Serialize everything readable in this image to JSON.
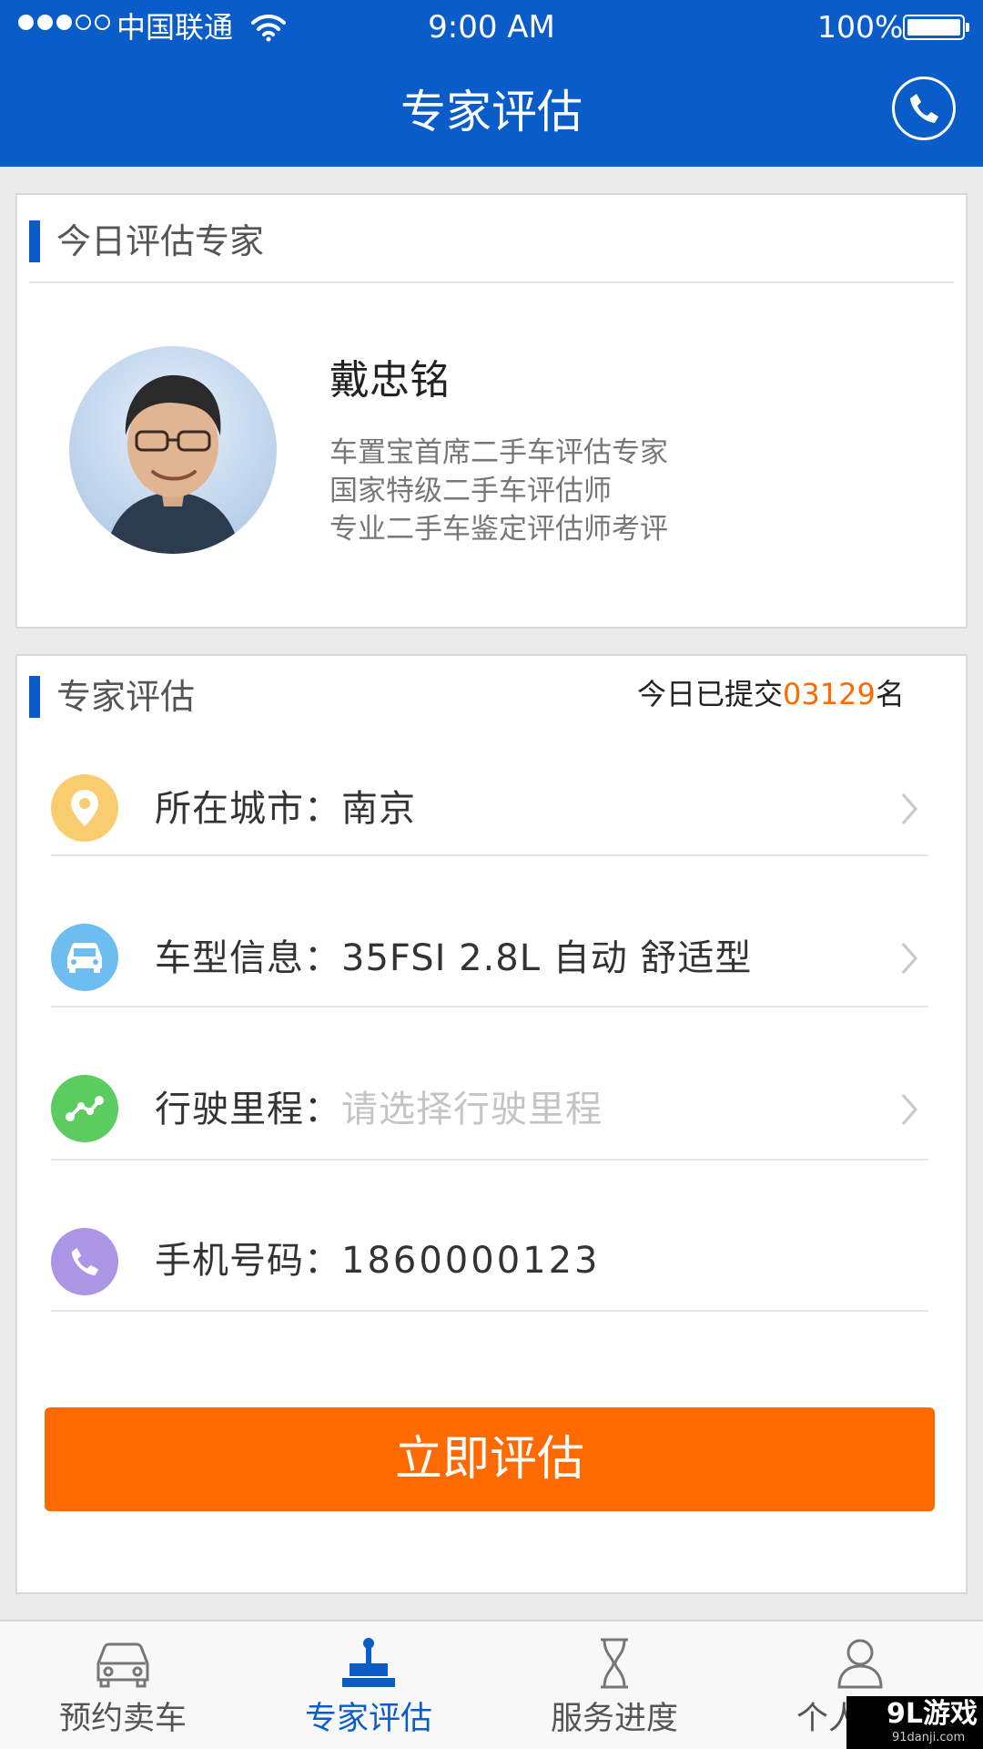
{
  "status_bar": {
    "carrier": "中国联通",
    "time": "9:00 AM",
    "battery": "100%"
  },
  "header": {
    "title": "专家评估",
    "phone_icon": "phone-icon"
  },
  "expert_card": {
    "section_title": "今日评估专家",
    "name": "戴忠铭",
    "titles": [
      "车置宝首席二手车评估专家",
      "国家特级二手车评估师",
      "专业二手车鉴定评估师考评"
    ]
  },
  "form_card": {
    "section_title": "专家评估",
    "count_prefix": "今日已提交",
    "count_value": "03129",
    "count_suffix": "名",
    "rows": [
      {
        "label": "所在城市：",
        "value": "南京",
        "icon": "location-pin-icon",
        "icon_color": "#f9cd6f",
        "has_chevron": true,
        "placeholder": false
      },
      {
        "label": "车型信息：",
        "value": "35FSI 2.8L 自动 舒适型",
        "icon": "car-icon",
        "icon_color": "#6dbdf0",
        "has_chevron": true,
        "placeholder": false
      },
      {
        "label": "行驶里程：",
        "value": "请选择行驶里程",
        "icon": "route-icon",
        "icon_color": "#5ccb60",
        "has_chevron": true,
        "placeholder": true
      },
      {
        "label": "手机号码：",
        "value": "1860000123",
        "icon": "phone-icon",
        "icon_color": "#ad95e6",
        "has_chevron": false,
        "placeholder": false
      }
    ],
    "submit_label": "立即评估"
  },
  "tabbar": {
    "tabs": [
      {
        "label": "预约卖车",
        "icon": "car-outline-icon",
        "active": false
      },
      {
        "label": "专家评估",
        "icon": "appraisal-icon",
        "active": true
      },
      {
        "label": "服务进度",
        "icon": "hourglass-icon",
        "active": false
      },
      {
        "label": "个人中心",
        "icon": "user-icon",
        "active": false
      }
    ]
  },
  "watermark": {
    "logo": "9L游戏",
    "site": "91danji.com"
  },
  "colors": {
    "brand_blue": "#0a5dc8",
    "accent_orange": "#ff6a00"
  }
}
